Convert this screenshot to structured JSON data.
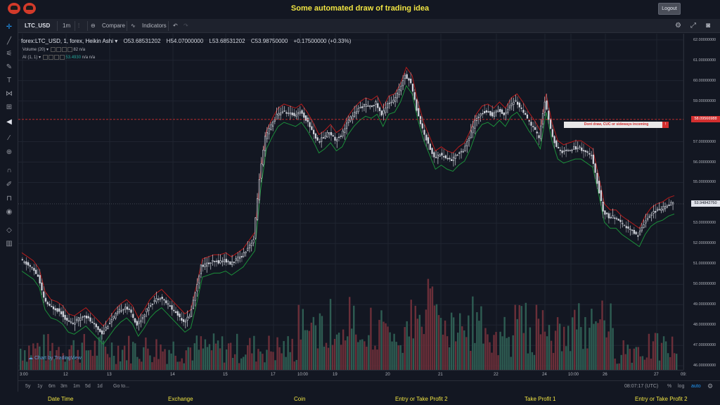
{
  "header": {
    "title": "Some automated draw of trading idea",
    "logout_label": "Logout"
  },
  "toolbar": {
    "symbol": "LTC_USD",
    "interval": "1m",
    "compare_label": "Compare",
    "indicators_label": "Indicators"
  },
  "legend": {
    "main": "forex:LTC_USD, 1, forex, Heikin Ashi",
    "open": "O53.68531202",
    "high": "H54.07000000",
    "low": "L53.68531202",
    "close": "C53.98750000",
    "change": "+0.17500000 (+0.33%)",
    "volume_label": "Volume (20)",
    "volume_value": "82",
    "volume_na": "n/a",
    "ai_label": "AI (1, 1)",
    "ai_value": "53.4930",
    "ai_na1": "n/a",
    "ai_na2": "n/a"
  },
  "annotation": {
    "text": "Dont draw, CUC or sideways incoming",
    "close": "!"
  },
  "price_axis": {
    "labels": [
      "62.00000000",
      "61.00000000",
      "60.00000000",
      "59.00000000",
      "57.00000000",
      "56.00000000",
      "55.00000000",
      "53.00000000",
      "52.00000000",
      "51.00000000",
      "50.00000000",
      "49.00000000",
      "48.00000000",
      "47.00000000",
      "46.00000000"
    ],
    "current_price": "53.94842750",
    "line_price": "58.09566988"
  },
  "time_axis": {
    "labels": [
      "3:00",
      "12",
      "13",
      "14",
      "15",
      "17",
      "10:00",
      "19",
      "20",
      "21",
      "22",
      "24",
      "10:00",
      "26",
      "27",
      "09:"
    ]
  },
  "bottom_bar": {
    "ranges": [
      "5y",
      "1y",
      "6m",
      "3m",
      "1m",
      "5d",
      "1d"
    ],
    "goto_label": "Go to...",
    "clock": "08:07:17 (UTC)",
    "percent": "%",
    "log": "log",
    "auto": "auto"
  },
  "footer": {
    "items": [
      "Date Time",
      "Exchange",
      "Coin",
      "Entry or Take Profit 2",
      "Take Profit 1",
      "Entry or Take Profit 2"
    ]
  },
  "watermark": "Chart by TradingView",
  "chart_data": {
    "type": "candlestick",
    "series": [
      {
        "name": "Heikin Ashi",
        "values": [
          51.2,
          51.0,
          50.8,
          50.4,
          49.3,
          48.9,
          48.8,
          48.6,
          48.2,
          48.1,
          48.3,
          48.5,
          48.2,
          47.9,
          47.6,
          48.0,
          48.4,
          48.7,
          48.9,
          48.6,
          48.0,
          48.4,
          48.9,
          49.2,
          49.4,
          49.1,
          48.8,
          48.5,
          48.2,
          48.4,
          49.6,
          50.9,
          51.0,
          51.1,
          51.1,
          51.2,
          51.0,
          51.2,
          51.4,
          51.8,
          52.2,
          55.2,
          57.2,
          57.8,
          58.3,
          58.5,
          58.4,
          58.3,
          58.5,
          58.1,
          57.6,
          57.0,
          57.2,
          57.5,
          57.1,
          57.3,
          57.9,
          58.3,
          58.6,
          58.8,
          58.7,
          58.9,
          58.3,
          58.9,
          59.0,
          59.5,
          60.3,
          59.9,
          58.6,
          57.6,
          56.9,
          56.2,
          56.4,
          56.2,
          56.1,
          56.4,
          56.6,
          57.2,
          58.0,
          58.4,
          58.5,
          58.3,
          58.6,
          58.3,
          58.8,
          59.0,
          58.6,
          58.1,
          57.7,
          57.2,
          59.0,
          57.6,
          56.7,
          56.5,
          56.6,
          56.7,
          56.7,
          56.5,
          56.3,
          55.0,
          53.6,
          53.3,
          53.3,
          53.0,
          52.8,
          52.6,
          52.4,
          53.0,
          53.4,
          53.6,
          53.7,
          53.9,
          54.0
        ]
      },
      {
        "name": "Volume",
        "values": []
      }
    ],
    "xlabel": "",
    "ylabel": "",
    "ylim": [
      45.8,
      62.3
    ]
  }
}
